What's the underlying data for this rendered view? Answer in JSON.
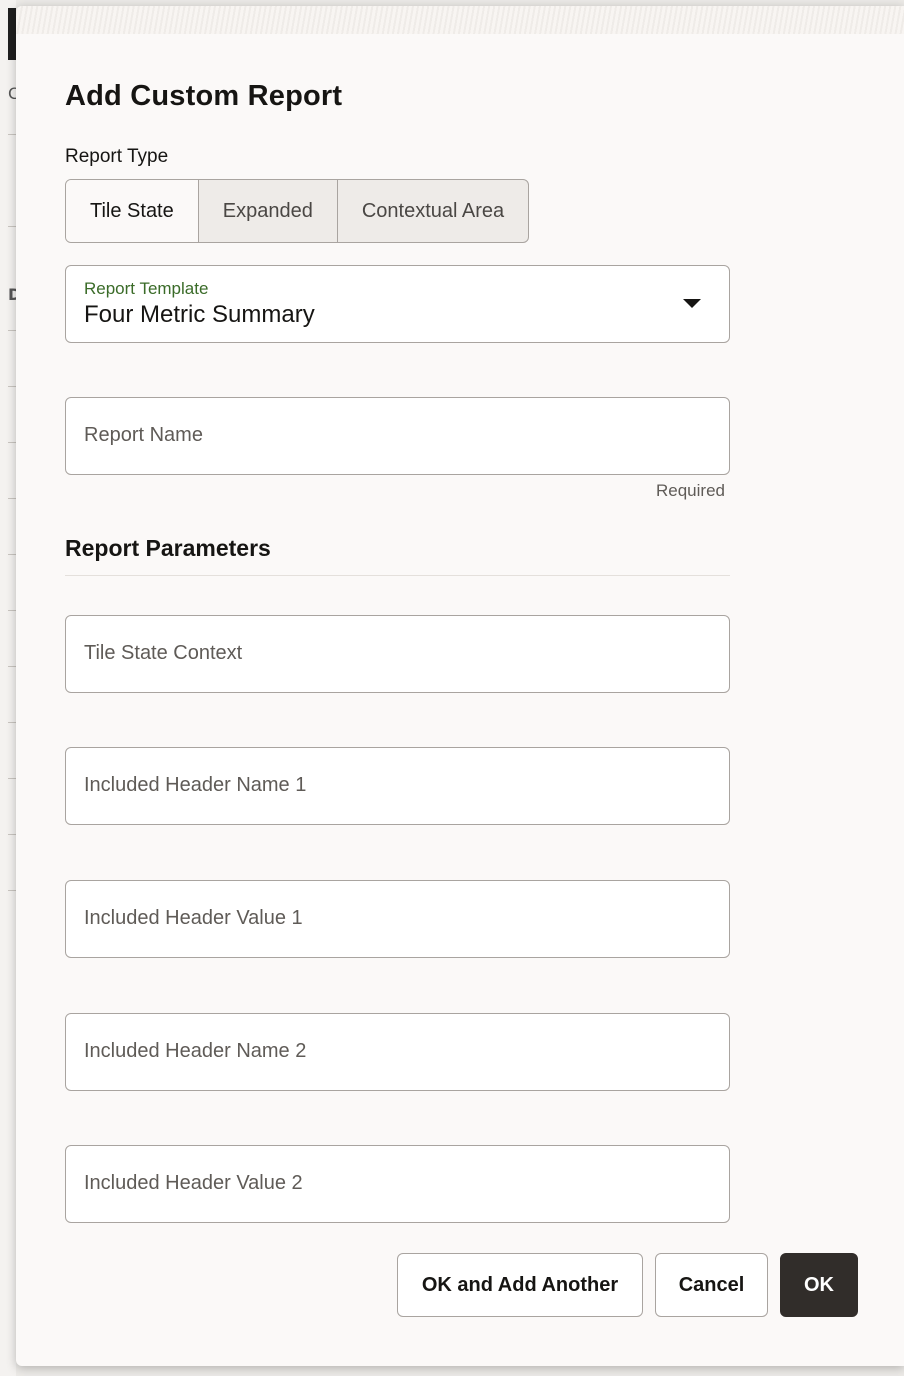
{
  "background": {
    "chars": [
      "C",
      "D"
    ]
  },
  "dialog": {
    "title": "Add Custom Report",
    "report_type": {
      "label": "Report Type",
      "options": [
        "Tile State",
        "Expanded",
        "Contextual Area"
      ],
      "selected": "Tile State"
    },
    "report_template": {
      "label": "Report Template",
      "value": "Four Metric Summary"
    },
    "report_name": {
      "placeholder": "Report Name",
      "helper": "Required"
    },
    "parameters": {
      "title": "Report Parameters",
      "fields": [
        "Tile State Context",
        "Included Header Name 1",
        "Included Header Value 1",
        "Included Header Name 2",
        "Included Header Value 2"
      ]
    },
    "buttons": {
      "ok_add_another": "OK and Add Another",
      "cancel": "Cancel",
      "ok": "OK"
    }
  },
  "colors": {
    "accent_label": "#3a6b28",
    "primary_button": "#312d2a",
    "dialog_bg": "#fbf9f8"
  }
}
